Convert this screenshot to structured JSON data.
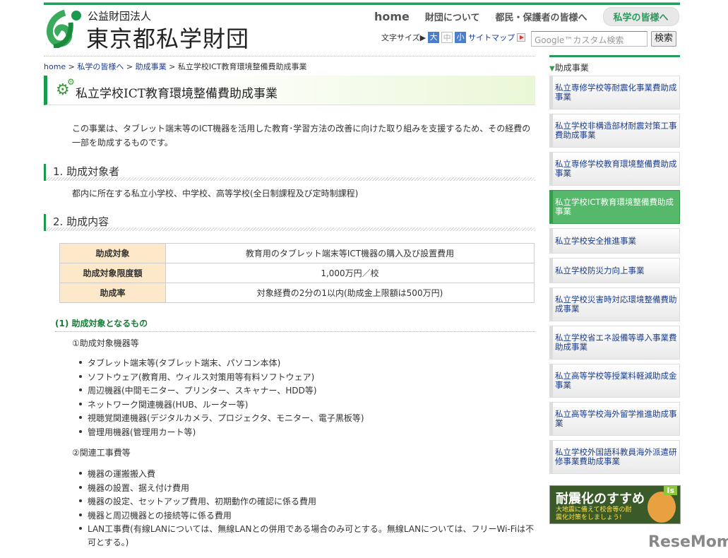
{
  "header": {
    "logo_sub": "公益財団法人",
    "logo_main": "東京都私学財団",
    "nav": [
      "home",
      "財団について",
      "都民・保護者の皆様へ",
      "私学の皆様へ"
    ],
    "font_size_label": "文字サイズ▶",
    "font_sizes": [
      "大",
      "中",
      "小"
    ],
    "sitemap": "サイトマップ",
    "search_placeholder": "Google™カスタム検索",
    "search_button": "検索"
  },
  "breadcrumb": [
    "home",
    "私学の皆様へ",
    "助成事業",
    "私立学校ICT教育環境整備費助成事業"
  ],
  "page_title": "私立学校ICT教育環境整備費助成事業",
  "intro": "この事業は、タブレット端末等のICT機器を活用した教育･学習方法の改善に向けた取り組みを支援するため、その経費の一部を助成するものです。",
  "section1": {
    "title": "1. 助成対象者",
    "text": "都内に所在する私立小学校、中学校、高等学校(全日制課程及び定時制課程)"
  },
  "section2": {
    "title": "2. 助成内容",
    "table": [
      [
        "助成対象",
        "教育用のタブレット端末等ICT機器の購入及び設置費用"
      ],
      [
        "助成対象限度額",
        "1,000万円／校"
      ],
      [
        "助成率",
        "対象経費の2分の1以内(助成金上限額は500万円)"
      ]
    ],
    "sub_title": "(1) 助成対象となるもの",
    "group1": {
      "title": "①助成対象機器等",
      "items": [
        "タブレット端末等(タブレット端末、パソコン本体)",
        "ソフトウェア(教育用、ウィルス対策用等有料ソフトウェア)",
        "周辺機器(中間モニター、プリンター、スキャナー、HDD等)",
        "ネットワーク関連機器(HUB、ルーター等)",
        "視聴覚関連機器(デジタルカメラ、プロジェクタ、モニター、電子黒板等)",
        "管理用機器(管理用カート等)"
      ]
    },
    "group2": {
      "title": "②関連工事費等",
      "items": [
        "機器の運搬搬入費",
        "機器の設置、据え付け費用",
        "機器の設定、セットアップ費用、初期動作の確認に係る費用",
        "機器と周辺機器との接続等に係る費用",
        "LAN工事費(有線LANについては、無線LANとの併用である場合のみ可とする。無線LANについては、フリーWi-Fiは不可とする。)"
      ]
    }
  },
  "sidebar": {
    "title": "助成事業",
    "items": [
      "私立専修学校等耐震化事業費助成事業",
      "私立学校非構造部材耐震対策工事費助成事業",
      "私立専修学校教育環境整備費助成事業",
      "私立学校ICT教育環境整備費助成事業",
      "私立学校安全推進事業",
      "私立学校防災力向上事業",
      "私立学校災害時対応環境整備費助成事業",
      "私立学校省エネ設備等導入事業費助成事業",
      "私立高等学校等授業料軽減助成金事業",
      "私立高等学校海外留学推進助成事業",
      "私立学校外国語科教員海外派遣研修事業費助成事業"
    ],
    "banner": {
      "title": "耐震化のすすめ",
      "text": "大地震に備えて校舎等の耐震化対策をしましょう!",
      "badge": "Is"
    }
  },
  "watermark": "ReseMom"
}
